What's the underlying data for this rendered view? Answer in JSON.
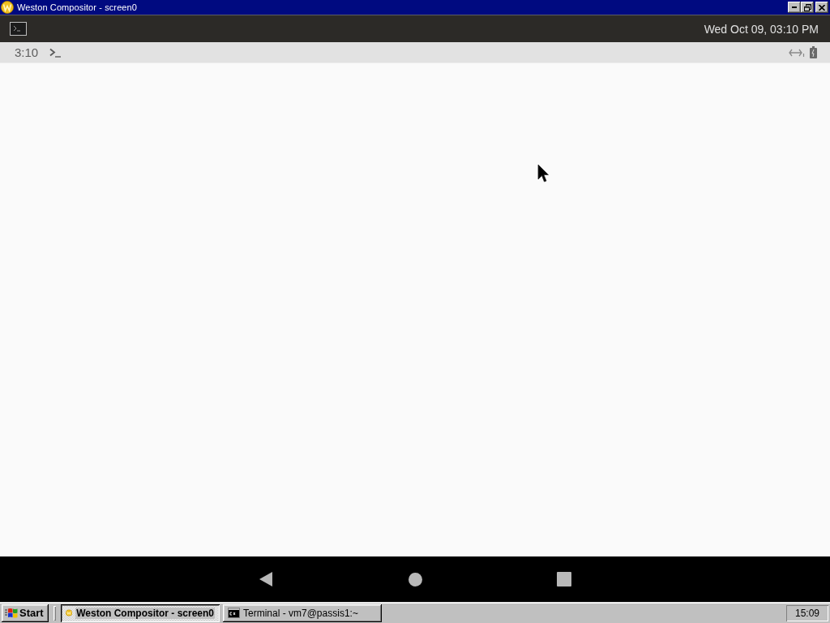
{
  "window": {
    "title": "Weston Compositor - screen0"
  },
  "panel": {
    "clock": "Wed Oct 09, 03:10 PM"
  },
  "status_bar": {
    "time": "3:10"
  },
  "taskbar": {
    "start": "Start",
    "tasks": [
      {
        "label": "Weston Compositor - screen0",
        "selected": true
      },
      {
        "label": "Terminal - vm7@passis1:~",
        "selected": false
      }
    ],
    "clock": "15:09"
  }
}
